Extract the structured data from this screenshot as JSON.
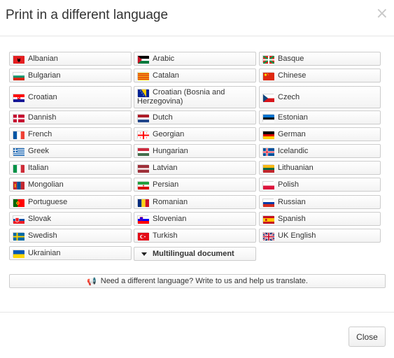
{
  "dialog": {
    "title": "Print in a different language",
    "close_glyph": "×",
    "help_label": "Need a different language? Write to us and help us translate.",
    "multilingual_label": "Multilingual document",
    "close_button_label": "Close"
  },
  "languages": [
    {
      "label": "Albanian",
      "icon": "albania-flag-icon",
      "colors": [
        "#e41e20",
        "#000000"
      ]
    },
    {
      "label": "Arabic",
      "icon": "arabic-flag-icon",
      "colors": [
        "#000000",
        "#ffffff",
        "#007a3d",
        "#ce1126"
      ]
    },
    {
      "label": "Basque",
      "icon": "basque-flag-icon",
      "colors": [
        "#d52b1e",
        "#009b48",
        "#ffffff"
      ]
    },
    {
      "label": "Bulgarian",
      "icon": "bulgaria-flag-icon",
      "colors": [
        "#ffffff",
        "#00966e",
        "#d62612"
      ]
    },
    {
      "label": "Catalan",
      "icon": "catalonia-flag-icon",
      "colors": [
        "#fcdd09",
        "#da121a"
      ]
    },
    {
      "label": "Chinese",
      "icon": "china-flag-icon",
      "colors": [
        "#de2910",
        "#ffde00"
      ]
    },
    {
      "label": "Croatian",
      "icon": "croatia-flag-icon",
      "colors": [
        "#ff0000",
        "#ffffff",
        "#171796"
      ]
    },
    {
      "label": "Croatian (Bosnia and Herzegovina)",
      "icon": "bosnia-flag-icon",
      "colors": [
        "#002395",
        "#fecb00"
      ]
    },
    {
      "label": "Czech",
      "icon": "czech-flag-icon",
      "colors": [
        "#ffffff",
        "#d7141a",
        "#11457e"
      ]
    },
    {
      "label": "Dannish",
      "icon": "denmark-flag-icon",
      "colors": [
        "#c60c30",
        "#ffffff"
      ]
    },
    {
      "label": "Dutch",
      "icon": "netherlands-flag-icon",
      "colors": [
        "#ae1c28",
        "#ffffff",
        "#21468b"
      ]
    },
    {
      "label": "Estonian",
      "icon": "estonia-flag-icon",
      "colors": [
        "#0072ce",
        "#000000",
        "#ffffff"
      ]
    },
    {
      "label": "French",
      "icon": "france-flag-icon",
      "colors": [
        "#0055a4",
        "#ffffff",
        "#ef4135"
      ]
    },
    {
      "label": "Georgian",
      "icon": "georgia-flag-icon",
      "colors": [
        "#ffffff",
        "#ff0000"
      ]
    },
    {
      "label": "German",
      "icon": "germany-flag-icon",
      "colors": [
        "#000000",
        "#dd0000",
        "#ffce00"
      ]
    },
    {
      "label": "Greek",
      "icon": "greece-flag-icon",
      "colors": [
        "#0d5eaf",
        "#ffffff"
      ]
    },
    {
      "label": "Hungarian",
      "icon": "hungary-flag-icon",
      "colors": [
        "#cd2a3e",
        "#ffffff",
        "#436f4d"
      ]
    },
    {
      "label": "Icelandic",
      "icon": "iceland-flag-icon",
      "colors": [
        "#02529c",
        "#ffffff",
        "#dc1e35"
      ]
    },
    {
      "label": "Italian",
      "icon": "italy-flag-icon",
      "colors": [
        "#009246",
        "#ffffff",
        "#ce2b37"
      ]
    },
    {
      "label": "Latvian",
      "icon": "latvia-flag-icon",
      "colors": [
        "#9e3039",
        "#ffffff"
      ]
    },
    {
      "label": "Lithuanian",
      "icon": "lithuania-flag-icon",
      "colors": [
        "#fdb913",
        "#006a44",
        "#c1272d"
      ]
    },
    {
      "label": "Mongolian",
      "icon": "mongolia-flag-icon",
      "colors": [
        "#c4272f",
        "#015197",
        "#f9cf02"
      ]
    },
    {
      "label": "Persian",
      "icon": "iran-flag-icon",
      "colors": [
        "#239f40",
        "#ffffff",
        "#da0000"
      ]
    },
    {
      "label": "Polish",
      "icon": "poland-flag-icon",
      "colors": [
        "#ffffff",
        "#dc143c"
      ]
    },
    {
      "label": "Portuguese",
      "icon": "portugal-flag-icon",
      "colors": [
        "#006600",
        "#ff0000"
      ]
    },
    {
      "label": "Romanian",
      "icon": "romania-flag-icon",
      "colors": [
        "#002b7f",
        "#fcd116",
        "#ce1126"
      ]
    },
    {
      "label": "Russian",
      "icon": "russia-flag-icon",
      "colors": [
        "#ffffff",
        "#0039a6",
        "#d52b1e"
      ]
    },
    {
      "label": "Slovak",
      "icon": "slovakia-flag-icon",
      "colors": [
        "#ffffff",
        "#0b4ea2",
        "#ee1c25"
      ]
    },
    {
      "label": "Slovenian",
      "icon": "slovenia-flag-icon",
      "colors": [
        "#ffffff",
        "#0000ff",
        "#ff0000"
      ]
    },
    {
      "label": "Spanish",
      "icon": "spain-flag-icon",
      "colors": [
        "#c60b1e",
        "#ffc400"
      ]
    },
    {
      "label": "Swedish",
      "icon": "sweden-flag-icon",
      "colors": [
        "#006aa7",
        "#fecc00"
      ]
    },
    {
      "label": "Turkish",
      "icon": "turkey-flag-icon",
      "colors": [
        "#e30a17",
        "#ffffff"
      ]
    },
    {
      "label": "UK English",
      "icon": "uk-flag-icon",
      "colors": [
        "#012169",
        "#ffffff",
        "#c8102e"
      ]
    },
    {
      "label": "Ukrainian",
      "icon": "ukraine-flag-icon",
      "colors": [
        "#0057b7",
        "#ffd700"
      ]
    }
  ]
}
